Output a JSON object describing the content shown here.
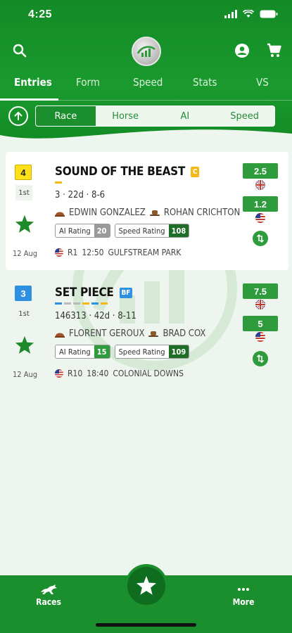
{
  "status": {
    "time": "4:25"
  },
  "tabs": [
    {
      "label": "Entries",
      "active": true
    },
    {
      "label": "Form"
    },
    {
      "label": "Speed"
    },
    {
      "label": "Stats"
    },
    {
      "label": "VS"
    }
  ],
  "segments": [
    {
      "label": "Race",
      "active": true
    },
    {
      "label": "Horse"
    },
    {
      "label": "AI"
    },
    {
      "label": "Speed"
    }
  ],
  "entries": [
    {
      "number": "4",
      "number_color": "#ffe01a",
      "place": "1st",
      "date": "12 Aug",
      "name": "SOUND OF THE BEAST",
      "tag": "C",
      "tag_color": "#f5b816",
      "form": "3 · 22d · 8-6",
      "jockey": "EDWIN GONZALEZ",
      "trainer": "ROHAN CRICHTON",
      "ai_rating_label": "AI Rating",
      "ai_rating": "20",
      "ai_color": "#9a9a9a",
      "speed_rating_label": "Speed Rating",
      "speed_rating": "108",
      "speed_color": "#1f6e27",
      "race_no": "R1",
      "race_time": "12:50",
      "course": "GULFSTREAM PARK",
      "odds": [
        "2.5",
        "1.2"
      ]
    },
    {
      "number": "3",
      "number_color": "#2f8fe0",
      "place": "1st",
      "date": "12 Aug",
      "name": "SET PIECE",
      "tag": "BF",
      "tag_color": "#2f8fe0",
      "form": "146313 · 42d · 8-11",
      "jockey": "FLORENT GEROUX",
      "trainer": "BRAD COX",
      "ai_rating_label": "AI Rating",
      "ai_rating": "15",
      "ai_color": "#2e9b3c",
      "speed_rating_label": "Speed Rating",
      "speed_rating": "109",
      "speed_color": "#1f6e27",
      "race_no": "R10",
      "race_time": "18:40",
      "course": "COLONIAL DOWNS",
      "odds": [
        "7.5",
        "5"
      ]
    }
  ],
  "bottom_nav": {
    "races": "Races",
    "more": "More"
  },
  "colors": {
    "primary": "#1b8f2d",
    "accent": "#2e9b3c"
  }
}
